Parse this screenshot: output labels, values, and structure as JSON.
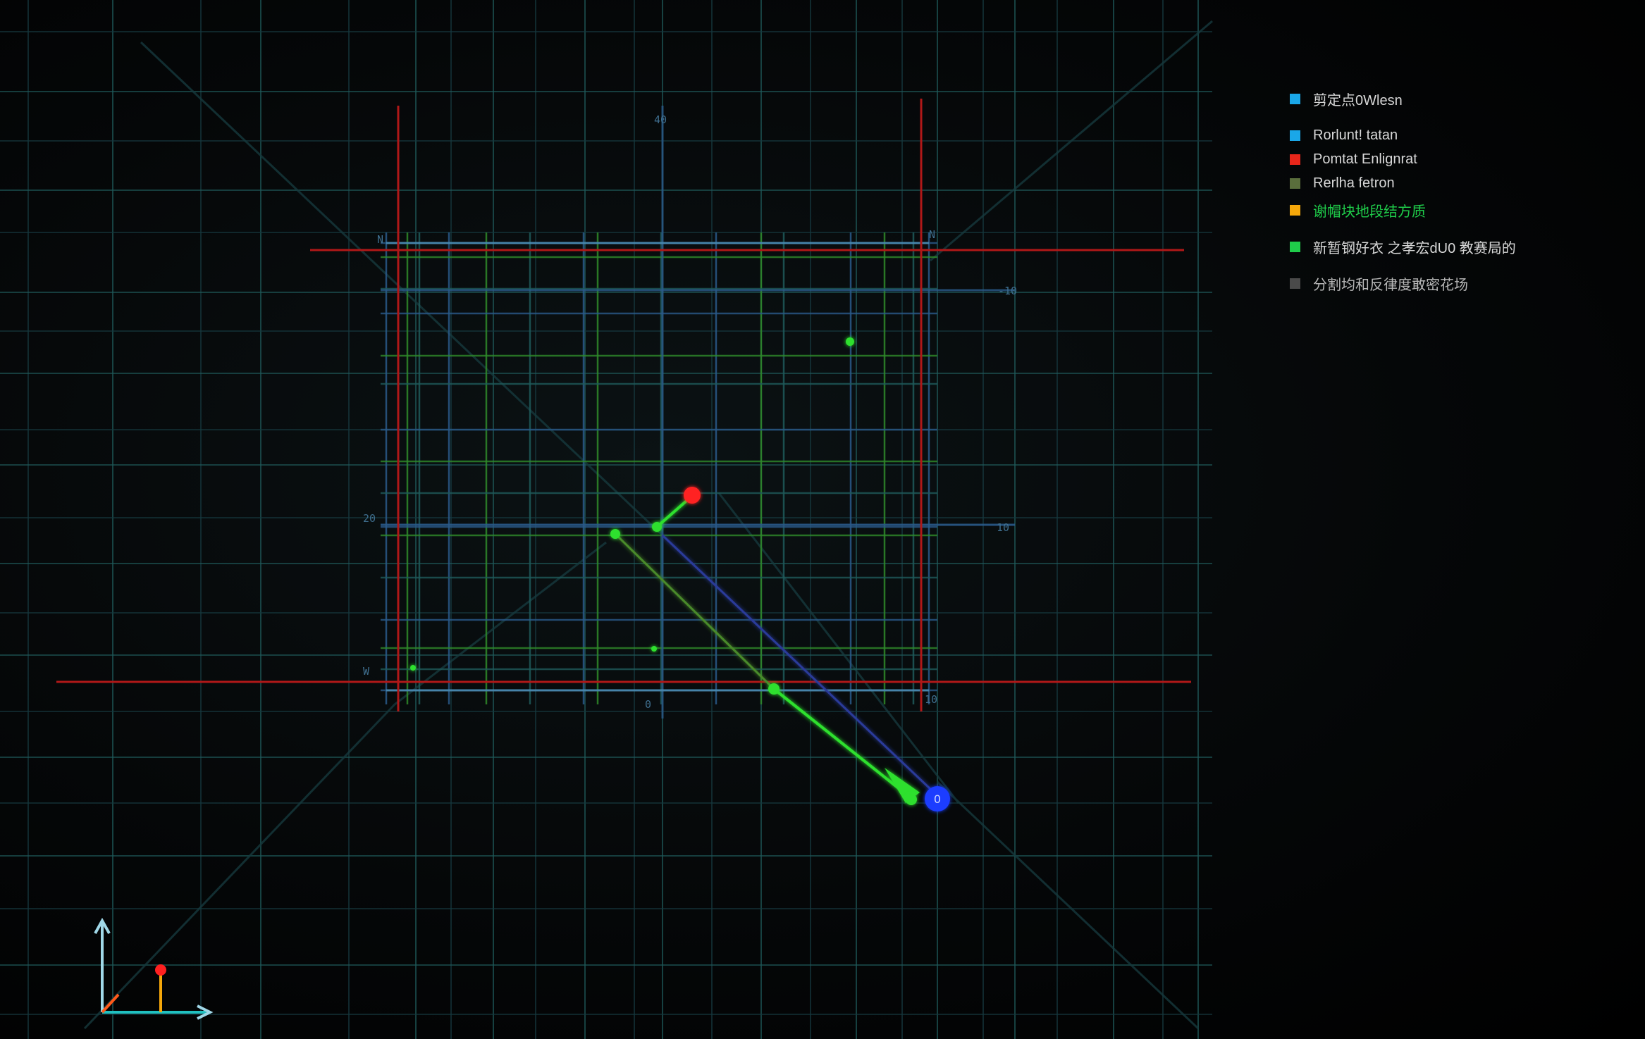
{
  "legend": {
    "items": [
      {
        "label": "剪定点0Wlesn",
        "color": "#1aa7e8"
      },
      {
        "label": "Rorlunt! tatan",
        "color": "#1aa7e8"
      },
      {
        "label": "Pomtat Enlignrat",
        "color": "#e8261a"
      },
      {
        "label": "Rerlha fetron",
        "color": "#5a6e3c"
      },
      {
        "label": "谢帽块地段结方质",
        "color": "#f5a70a"
      },
      {
        "label": "新暂钢好衣 之孝宏dU0 教赛局的",
        "color": "#1fcc4a"
      },
      {
        "label": "分割均和反律度敢密花场",
        "color": "#4a4a4a"
      }
    ]
  },
  "axis_labels": {
    "top": "40",
    "left_mid": "20",
    "right_upper": "-10",
    "right_mid": "10",
    "bottom_center": "0",
    "corner_top_left": "N",
    "corner_top_right": "N",
    "corner_bottom_left": "W",
    "corner_bottom_right": "10"
  },
  "marker_labels": {
    "blue_marker": "0"
  },
  "colors": {
    "grid_teal": "#1f5a5a",
    "grid_blue": "#2a5a8a",
    "grid_green": "#2f8a2a",
    "frame_red": "#b01818",
    "point_green": "#2de02d",
    "point_red": "#ff2020",
    "point_blue": "#1a3cff",
    "axis_x": "#20c0c0",
    "axis_y": "#a0d8e8",
    "axis_z": "#f5a70a"
  }
}
